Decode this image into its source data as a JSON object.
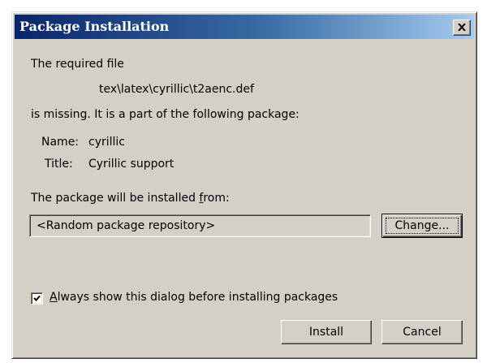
{
  "dialog": {
    "title": "Package Installation",
    "close_glyph": "×"
  },
  "message": {
    "intro": "The required file",
    "file_path": "tex\\latex\\cyrillic\\t2aenc.def",
    "missing_line": "is missing. It is a part of the following package:",
    "name_label": "Name:",
    "name_value": "cyrillic",
    "title_label": "Title:",
    "title_value": "Cyrillic support",
    "install_from_prefix": "The package will be installed ",
    "install_from_underlined": "f",
    "install_from_suffix": "rom:"
  },
  "repository": {
    "value": "<Random package repository>"
  },
  "buttons": {
    "change": "Change...",
    "install": "Install",
    "cancel": "Cancel"
  },
  "checkbox": {
    "checked": true,
    "label_underlined": "A",
    "label_rest": "lways show this dialog before installing packages"
  },
  "icons": {
    "close": "close-icon",
    "check": "check-icon"
  }
}
